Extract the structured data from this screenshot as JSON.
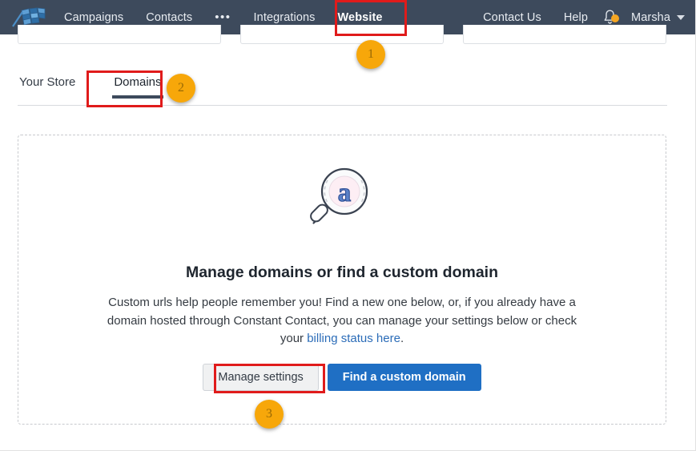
{
  "navbar": {
    "logo_icon": "constant-contact-flag-logo",
    "items": [
      {
        "label": "Campaigns",
        "active": false
      },
      {
        "label": "Contacts",
        "active": false
      },
      {
        "label": "•••",
        "active": false
      },
      {
        "label": "Integrations",
        "active": false
      },
      {
        "label": "Website",
        "active": true
      }
    ],
    "right_items": [
      {
        "label": "Contact Us"
      },
      {
        "label": "Help"
      }
    ],
    "bell_icon": "notification-bell-icon",
    "bell_has_alert": true,
    "account_name": "Marsha",
    "background_color": "#3d4a5c",
    "active_underline_color": "#7fb0d8"
  },
  "tabs": [
    {
      "label": "Your Store",
      "active": false
    },
    {
      "label": "Domains",
      "active": true
    }
  ],
  "panel": {
    "illustration_icon": "magnifier-with-letter-a-icon",
    "headline": "Manage domains or find a custom domain",
    "body_part_1": "Custom urls help people remember you! Find a new one below, or, if you already have a domain hosted through Constant Contact, you can manage your settings below or check your ",
    "body_link": "billing status here",
    "body_part_2": ".",
    "buttons": {
      "secondary_label": "Manage settings",
      "primary_label": "Find a custom domain"
    }
  },
  "annotations": {
    "badges": [
      {
        "number": "1",
        "target": "website-nav-item"
      },
      {
        "number": "2",
        "target": "domains-tab"
      },
      {
        "number": "3",
        "target": "manage-settings-button"
      }
    ],
    "highlight_color": "#e01b1b",
    "badge_color": "#f7a70a"
  },
  "colors": {
    "primary_button": "#1f6fc4",
    "link": "#2b6cb8",
    "text": "#333b45"
  }
}
